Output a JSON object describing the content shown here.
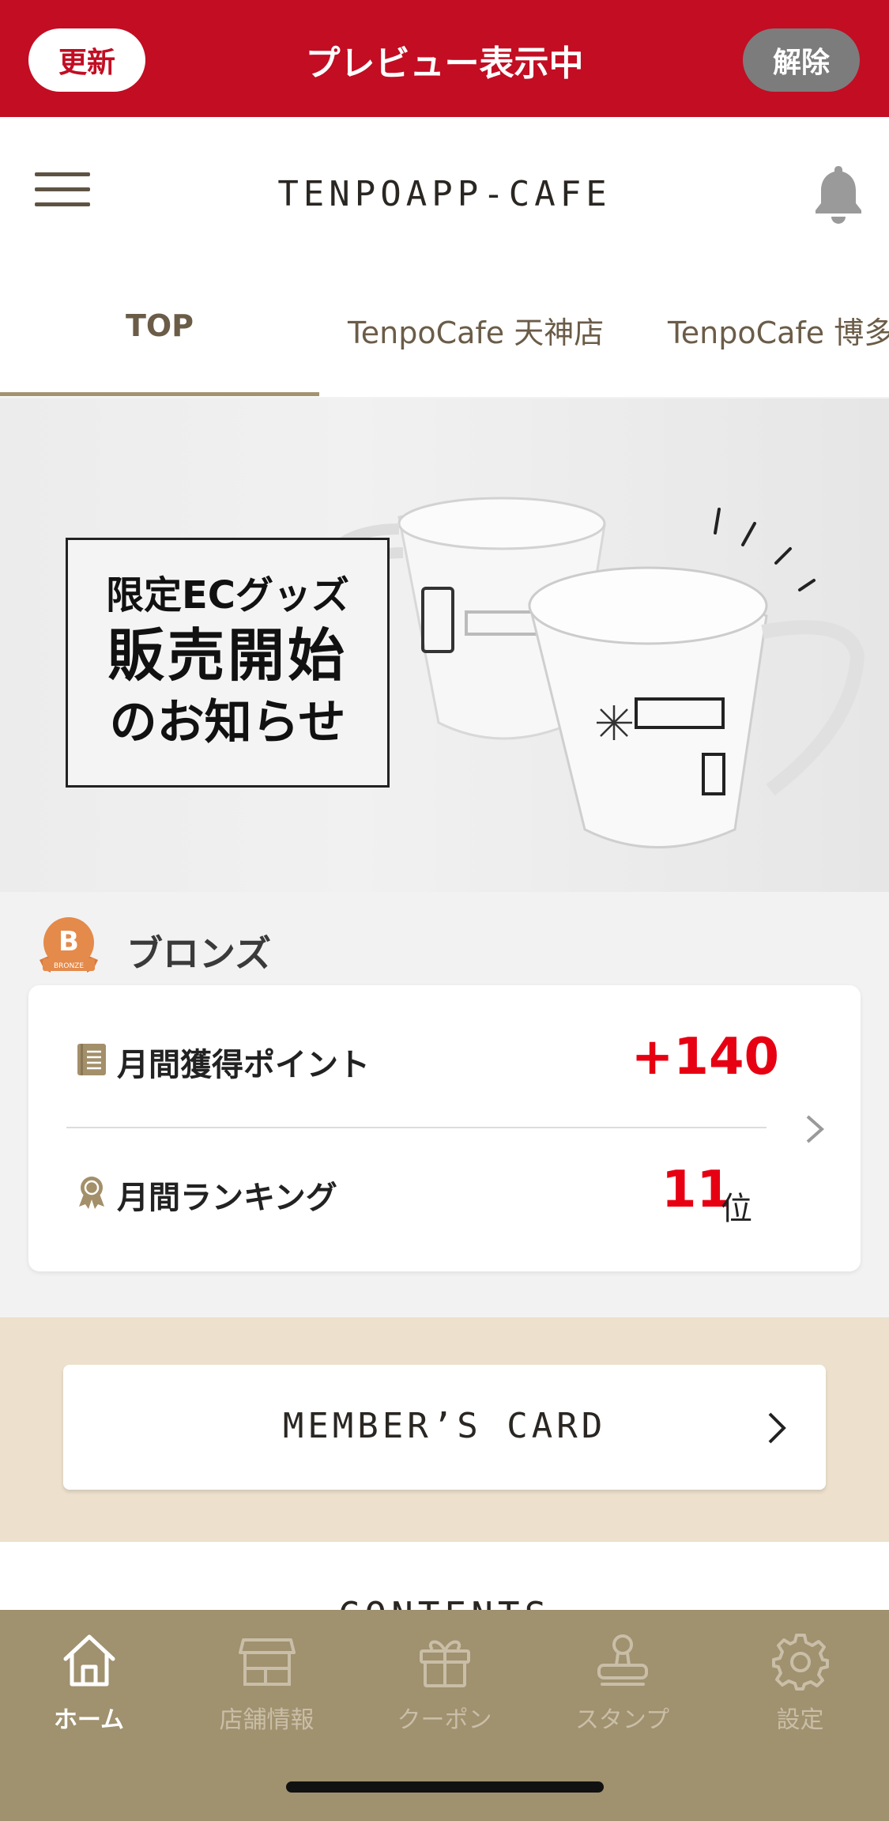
{
  "preview_bar": {
    "refresh_label": "更新",
    "title": "プレビュー表示中",
    "cancel_label": "解除"
  },
  "header": {
    "app_name": "TENPOAPP-CAFE"
  },
  "tabs": [
    {
      "label": "TOP",
      "active": true
    },
    {
      "label": "TenpoCafe 天神店",
      "active": false
    },
    {
      "label": "TenpoCafe 博多",
      "active": false
    }
  ],
  "banner": {
    "line1": "限定ECグッズ",
    "line2": "販売開始",
    "line3": "のお知らせ"
  },
  "rank": {
    "badge_text": "BRONZE",
    "badge_letter": "B",
    "label": "ブロンズ",
    "points_label": "月間獲得ポイント",
    "points_value": "+140",
    "ranking_label": "月間ランキング",
    "ranking_value": "11",
    "ranking_unit": "位"
  },
  "member_card": {
    "label": "MEMBER’S CARD"
  },
  "contents": {
    "title": "CONTENTS"
  },
  "bottom_nav": [
    {
      "label": "ホーム",
      "icon": "home-icon",
      "active": true
    },
    {
      "label": "店舗情報",
      "icon": "store-icon",
      "active": false
    },
    {
      "label": "クーポン",
      "icon": "gift-icon",
      "active": false
    },
    {
      "label": "スタンプ",
      "icon": "stamp-icon",
      "active": false
    },
    {
      "label": "設定",
      "icon": "gear-icon",
      "active": false
    }
  ],
  "colors": {
    "preview_red": "#c20d23",
    "accent_red": "#e60012",
    "nav_brown": "#a0916f",
    "tab_underline": "#a39372",
    "member_bg": "#ede1cd"
  }
}
